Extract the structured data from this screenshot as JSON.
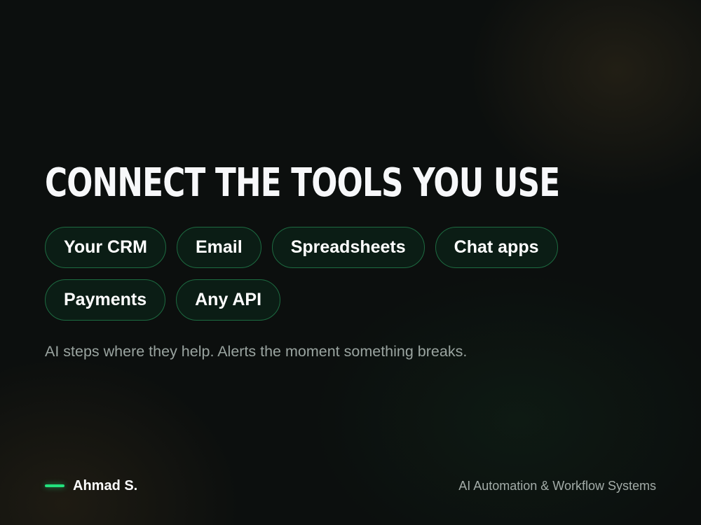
{
  "hero": {
    "headline": "Connect the tools you use",
    "chips": [
      "Your CRM",
      "Email",
      "Spreadsheets",
      "Chat apps",
      "Payments",
      "Any API"
    ],
    "tagline": "AI steps where they help. Alerts the moment something breaks."
  },
  "footer": {
    "author": "Ahmad S.",
    "role": "AI Automation & Workflow Systems"
  },
  "colors": {
    "background": "#0c0f0e",
    "accent": "#22e07c",
    "chip_border": "#1d6b41",
    "chip_fill": "#0b1d15",
    "muted_text": "#9aa4a0"
  }
}
